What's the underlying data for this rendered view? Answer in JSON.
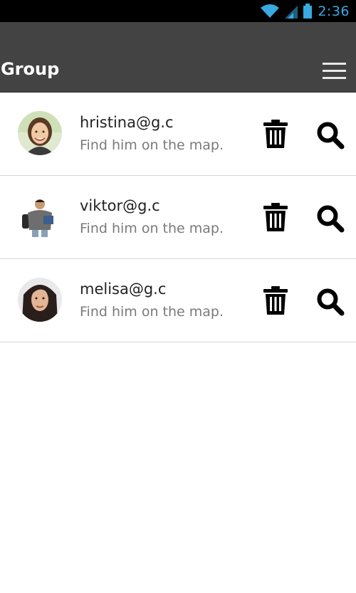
{
  "status_bar": {
    "time": "2:36",
    "icons": [
      "wifi-icon",
      "cell-signal-icon",
      "battery-icon"
    ],
    "accent_color": "#39a9e0"
  },
  "app_bar": {
    "title": "Group",
    "menu_icon": "hamburger-menu-icon",
    "background": "#434343"
  },
  "members": [
    {
      "email": "hristina@g.c",
      "subtitle": "Find him on the map.",
      "avatar": "woman-portrait",
      "actions": [
        "trash-icon",
        "search-icon"
      ]
    },
    {
      "email": "viktor@g.c",
      "subtitle": "Find him on the map.",
      "avatar": "man-portrait",
      "actions": [
        "trash-icon",
        "search-icon"
      ]
    },
    {
      "email": "melisa@g.c",
      "subtitle": "Find him on the map.",
      "avatar": "woman-portrait",
      "actions": [
        "trash-icon",
        "search-icon"
      ]
    }
  ]
}
